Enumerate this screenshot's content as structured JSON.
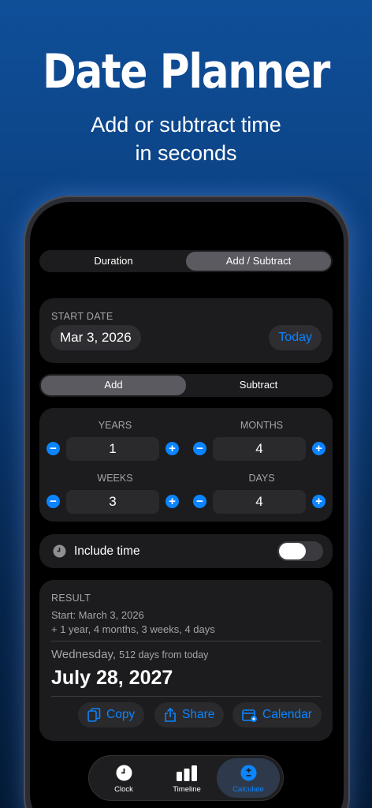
{
  "hero": {
    "title": "Date Planner",
    "subtitle_line1": "Add or subtract time",
    "subtitle_line2": "in seconds"
  },
  "mode_tabs": {
    "duration": "Duration",
    "add_subtract": "Add / Subtract",
    "selected": "Add / Subtract"
  },
  "start": {
    "label": "START DATE",
    "value": "Mar 3, 2026",
    "today_button": "Today"
  },
  "operation": {
    "add": "Add",
    "subtract": "Subtract",
    "selected": "Add"
  },
  "steppers": {
    "years": {
      "label": "YEARS",
      "value": "1"
    },
    "months": {
      "label": "MONTHS",
      "value": "4"
    },
    "weeks": {
      "label": "WEEKS",
      "value": "3"
    },
    "days": {
      "label": "DAYS",
      "value": "4"
    }
  },
  "include_time": {
    "label": "Include time",
    "enabled": false
  },
  "result": {
    "label": "RESULT",
    "start_line": "Start: March 3, 2026",
    "delta_line": "+ 1 year, 4 months, 3 weeks, 4 days",
    "weekday": "Wednesday,",
    "days_from_today": "512 days from today",
    "date": "July 28, 2027",
    "actions": {
      "copy": "Copy",
      "share": "Share",
      "calendar": "Calendar"
    }
  },
  "tabbar": {
    "items": [
      {
        "label": "Clock",
        "icon": "clock-icon"
      },
      {
        "label": "Timeline",
        "icon": "bar-chart-icon"
      },
      {
        "label": "Calculate",
        "icon": "plus-minus-icon",
        "active": true
      }
    ]
  },
  "colors": {
    "accent": "#0a84ff",
    "card": "#1c1c1e",
    "background_top": "#0f4f99"
  }
}
